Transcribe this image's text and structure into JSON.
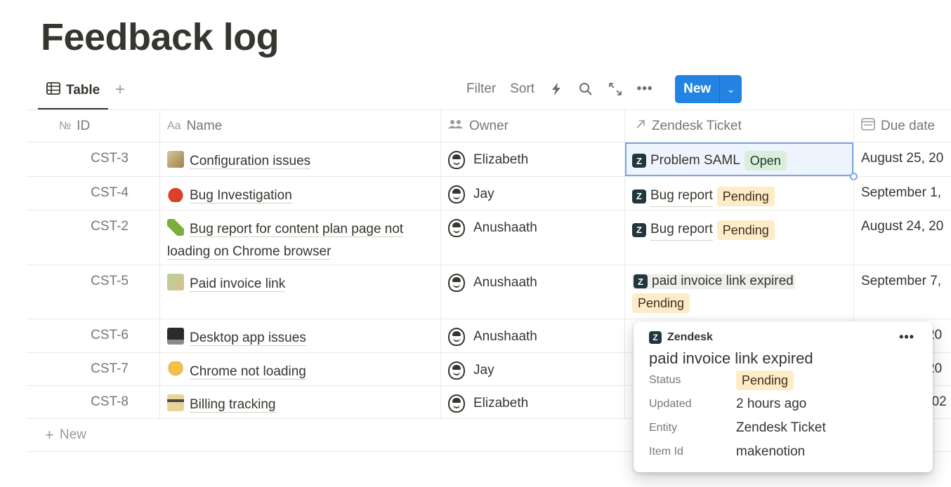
{
  "page": {
    "title": "Feedback log"
  },
  "toolbar": {
    "view_tab": "Table",
    "filter": "Filter",
    "sort": "Sort",
    "new_label": "New"
  },
  "columns": {
    "id": "ID",
    "id_prefix": "№",
    "name": "Name",
    "name_prefix": "Aa",
    "owner": "Owner",
    "ticket": "Zendesk Ticket",
    "due": "Due date"
  },
  "rows": [
    {
      "id": "CST-3",
      "name": "Configuration issues",
      "name2": "",
      "owner": "Elizabeth",
      "ticket": "Problem SAML",
      "status": "Open",
      "due": "August 25, 20"
    },
    {
      "id": "CST-4",
      "name": "Bug Investigation",
      "name2": "",
      "owner": "Jay",
      "ticket": "Bug report",
      "status": "Pending",
      "due": "September 1,"
    },
    {
      "id": "CST-2",
      "name": "Bug report for content plan page not",
      "name2": "loading on Chrome browser",
      "owner": "Anushaath",
      "ticket": "Bug report",
      "status": "Pending",
      "due": "August 24, 20"
    },
    {
      "id": "CST-5",
      "name": "Paid invoice link",
      "name2": "",
      "owner": "Anushaath",
      "ticket": "paid invoice link expired",
      "status": "Pending",
      "due": "September 7,"
    },
    {
      "id": "CST-6",
      "name": "Desktop app issues",
      "name2": "",
      "owner": "Anushaath",
      "ticket": "",
      "status": "",
      "due": "20"
    },
    {
      "id": "CST-7",
      "name": "Chrome not loading",
      "name2": "",
      "owner": "Jay",
      "ticket": "",
      "status": "",
      "due": "20"
    },
    {
      "id": "CST-8",
      "name": "Billing tracking",
      "name2": "",
      "owner": "Elizabeth",
      "ticket": "",
      "status": "",
      "due": "202"
    }
  ],
  "new_row": "New",
  "popup": {
    "source": "Zendesk",
    "title": "paid invoice link expired",
    "status_key": "Status",
    "status_val": "Pending",
    "updated_key": "Updated",
    "updated_val": "2 hours ago",
    "entity_key": "Entity",
    "entity_val": "Zendesk Ticket",
    "item_key": "Item Id",
    "item_val": "makenotion"
  },
  "colors": {
    "accent": "#2383e2",
    "open_bg": "#dbeddb",
    "pending_bg": "#fdecc8"
  }
}
